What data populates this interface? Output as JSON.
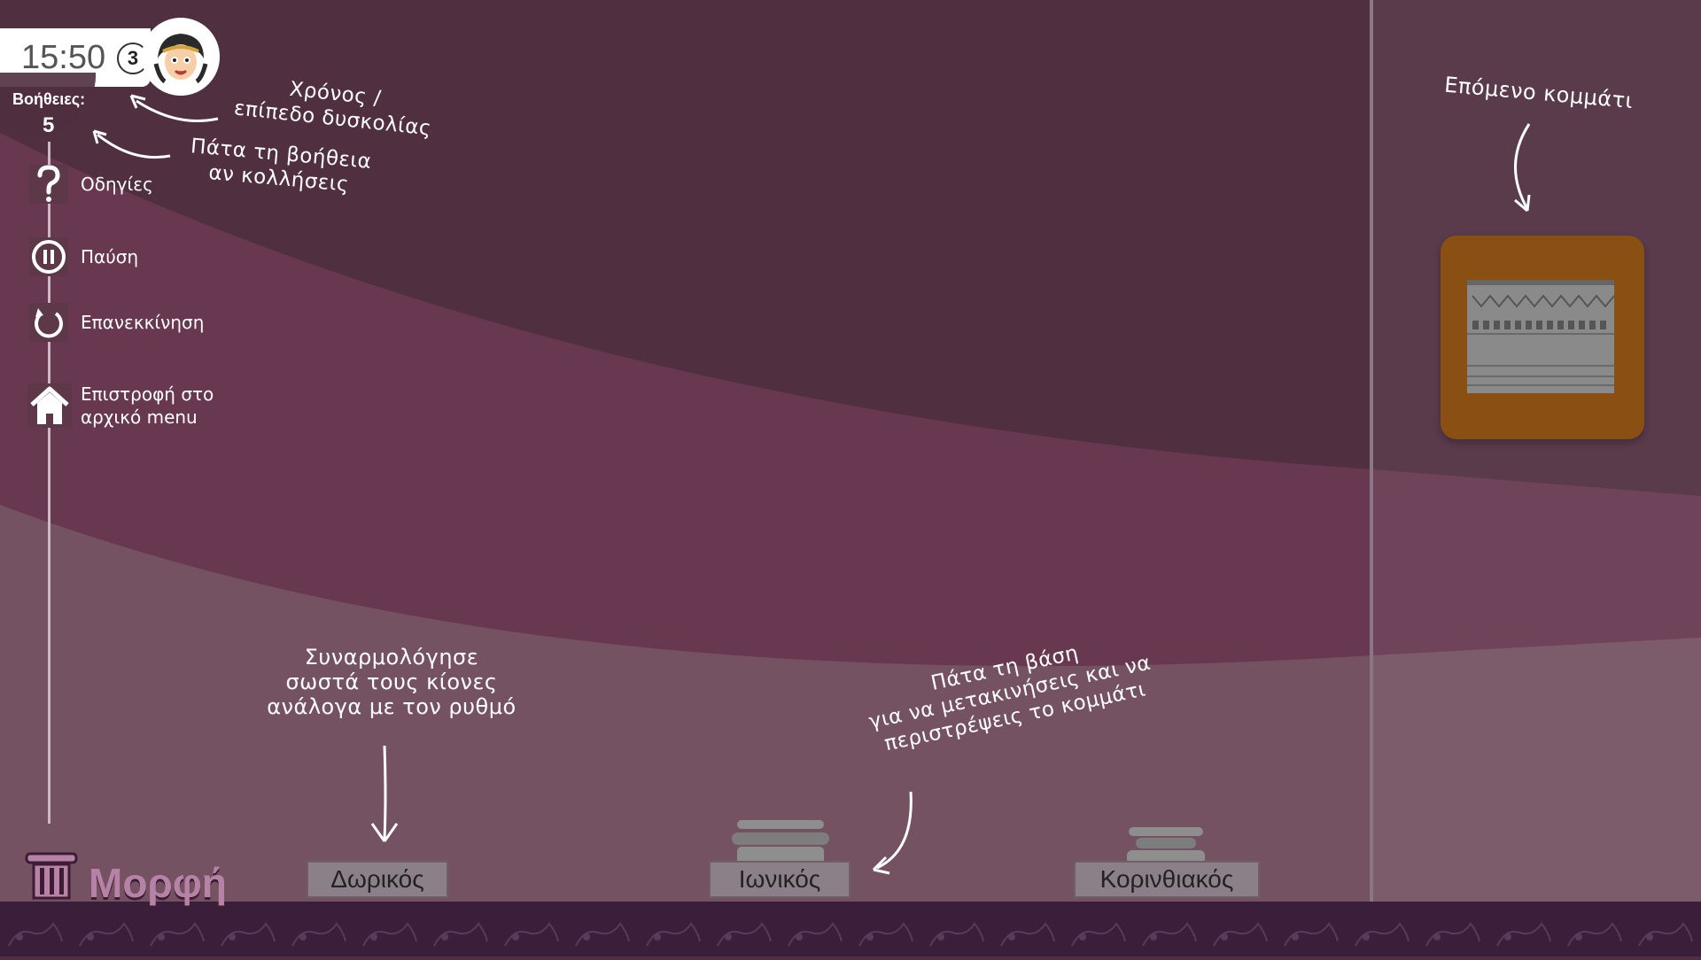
{
  "hud": {
    "time": "15:50",
    "level": "3",
    "help_label": "Βοήθειες:",
    "help_count": "5"
  },
  "menu": {
    "items": [
      {
        "label": "Οδηγίες",
        "icon": "question-icon"
      },
      {
        "label": "Παύση",
        "icon": "pause-icon"
      },
      {
        "label": "Επανεκκίνηση",
        "icon": "restart-icon"
      },
      {
        "label": "Επιστροφή στο\nαρχικό menu",
        "icon": "home-icon"
      }
    ]
  },
  "annotations": {
    "time_level": "Χρόνος /\nεπίπεδο δυσκολίας",
    "help_hint": "Πάτα τη βοήθεια\nαν κολλήσεις",
    "next_piece": "Επόμενο κομμάτι",
    "assemble": "Συναρμολόγησε\nσωστά τους κίονες\nανάλογα με τον ρυθμό",
    "base_hint": "Πάτα τη βάση\nγια να μετακινήσεις και να\nπεριστρέψεις το κομμάτι"
  },
  "orders": [
    {
      "label": "Δωρικός"
    },
    {
      "label": "Ιωνικός"
    },
    {
      "label": "Κορινθιακός"
    }
  ],
  "title": "Μορφή",
  "colors": {
    "bg_dark": "#4f2f40",
    "bg_mid": "#673850",
    "bg_light": "#745262",
    "side_panel": "#5a3d4c",
    "tile": "#8a4f12",
    "bottom_bar": "#3a1e3a",
    "title": "#b683a6"
  }
}
